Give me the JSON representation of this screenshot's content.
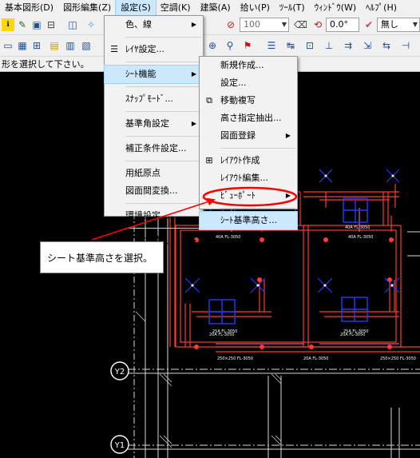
{
  "menubar": {
    "items": [
      "基本図形(D)",
      "図形編集(Z)",
      "設定(S)",
      "空調(K)",
      "建築(A)",
      "拾い(P)",
      "ﾂｰﾙ(T)",
      "ｳｨﾝﾄﾞｳ(W)",
      "ﾍﾙﾌﾟ(H)"
    ]
  },
  "toolbar": {
    "combo_100": "100",
    "combo_angle": "0.0°",
    "combo_none": "無し"
  },
  "status": {
    "text": "形を選択して下さい。"
  },
  "settings_menu": {
    "items": [
      {
        "label": "色、線",
        "submenu": true
      },
      {
        "label": "ﾚｲﾔ設定...",
        "submenu": false
      },
      {
        "label": "ｼｰﾄ機能",
        "submenu": true
      },
      {
        "label": "ｽﾅｯﾌﾟﾓｰﾄﾞ...",
        "submenu": false
      },
      {
        "label": "基準角設定",
        "submenu": true
      },
      {
        "label": "補正条件設定...",
        "submenu": false
      },
      {
        "label": "用紙原点",
        "submenu": false
      },
      {
        "label": "図面間変換...",
        "submenu": false
      },
      {
        "label": "環境設定...",
        "submenu": false
      },
      {
        "label": "設備切替え",
        "submenu": true
      }
    ]
  },
  "sheet_menu": {
    "items": [
      {
        "label": "新規作成...",
        "submenu": false
      },
      {
        "label": "設定...",
        "submenu": false
      },
      {
        "label": "移動複写",
        "submenu": false
      },
      {
        "label": "高さ指定抽出...",
        "submenu": false
      },
      {
        "label": "図面登録",
        "submenu": true
      },
      {
        "label": "ﾚｲｱｳﾄ作成",
        "submenu": false
      },
      {
        "label": "ﾚｲｱｳﾄ編集...",
        "submenu": false
      },
      {
        "label": "ﾋﾞｭｰﾎﾟｰﾄ",
        "submenu": true
      },
      {
        "label": "ｼｰﾄ基準高さ...",
        "submenu": false
      }
    ]
  },
  "callout": {
    "text": "シート基準高さを選択。"
  },
  "drawing": {
    "grid_labels": [
      "Y2",
      "Y1"
    ],
    "dim_labels": [
      "40A FL-3050",
      "40A FL-3050",
      "20A FL-3050",
      "20A FL-3050",
      "25A FL-3050",
      "25A FL-3050",
      "40A FL-3050",
      "40A FL-3050",
      "250×250 FL-3050",
      "20A FL-3050",
      "250×250 FL-3050"
    ]
  },
  "colors": {
    "menu_bg": "#f2f2f2",
    "highlight": "#cce8ff",
    "annotation_red": "#ff0000",
    "duct_red": "#ff3b30",
    "equipment_blue": "#1f3cff",
    "canvas": "#000000"
  }
}
